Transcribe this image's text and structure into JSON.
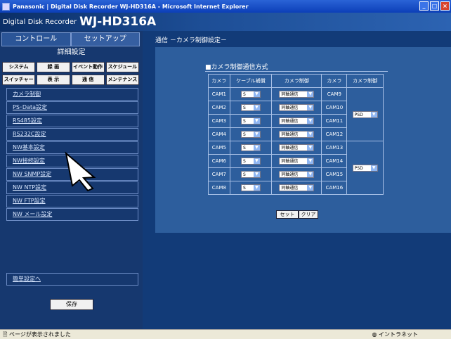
{
  "window": {
    "title": "Panasonic | Digital Disk Recorder WJ-HD316A - Microsoft Internet Explorer"
  },
  "header": {
    "small": "Digital Disk Recorder",
    "big": "WJ-HD316A"
  },
  "left": {
    "tabs": [
      "コントロール",
      "セットアップ"
    ],
    "subtitle": "詳細設定",
    "menu_row1": [
      "システム",
      "録 画",
      "イベント動作",
      "スケジュール"
    ],
    "menu_row2": [
      "スイッチャー",
      "表 示",
      "通 信",
      "メンテナンス"
    ],
    "submenu": [
      "カメラ制御",
      "PS･Data設定",
      "RS485設定",
      "RS232C設定",
      "NW基本設定",
      "NW接続設定",
      "NW SNMP設定",
      "NW NTP設定",
      "NW FTP設定",
      "NW メール設定"
    ],
    "easy": "簡単設定へ",
    "save": "保存"
  },
  "right": {
    "breadcrumb": "通信 －カメラ制御設定－",
    "section": "■カメラ制御通信方式",
    "headers": [
      "カメラ",
      "ケーブル補償",
      "カメラ制御",
      "カメラ",
      "カメラ制御"
    ],
    "rows": [
      {
        "camera": "CAM1",
        "cable": "S",
        "control": "同軸通信",
        "camera2": "CAM9"
      },
      {
        "camera": "CAM2",
        "cable": "S",
        "control": "同軸通信",
        "camera2": "CAM10"
      },
      {
        "camera": "CAM3",
        "cable": "S",
        "control": "同軸通信",
        "camera2": "CAM11"
      },
      {
        "camera": "CAM4",
        "cable": "S",
        "control": "同軸通信",
        "camera2": "CAM12"
      },
      {
        "camera": "CAM5",
        "cable": "S",
        "control": "同軸通信",
        "camera2": "CAM13"
      },
      {
        "camera": "CAM6",
        "cable": "S",
        "control": "同軸通信",
        "camera2": "CAM14"
      },
      {
        "camera": "CAM7",
        "cable": "S",
        "control": "同軸通信",
        "camera2": "CAM15"
      },
      {
        "camera": "CAM8",
        "cable": "S",
        "control": "同軸通信",
        "camera2": "CAM16"
      }
    ],
    "groups": [
      "PSD",
      "PSD"
    ],
    "buttons": {
      "set": "セット",
      "clear": "クリア"
    }
  },
  "status": {
    "left": "ページが表示されました",
    "right": "イントラネット"
  },
  "icons": {
    "app": "ie-icon",
    "minimize": "minimize-icon",
    "restore": "restore-icon",
    "close": "close-icon",
    "cursor": "pointer-cursor-icon",
    "page": "page-icon",
    "zone": "intranet-icon"
  },
  "colors": {
    "panel": "#2d5e9d",
    "left": "#16386f",
    "header": "#0b2f67"
  }
}
